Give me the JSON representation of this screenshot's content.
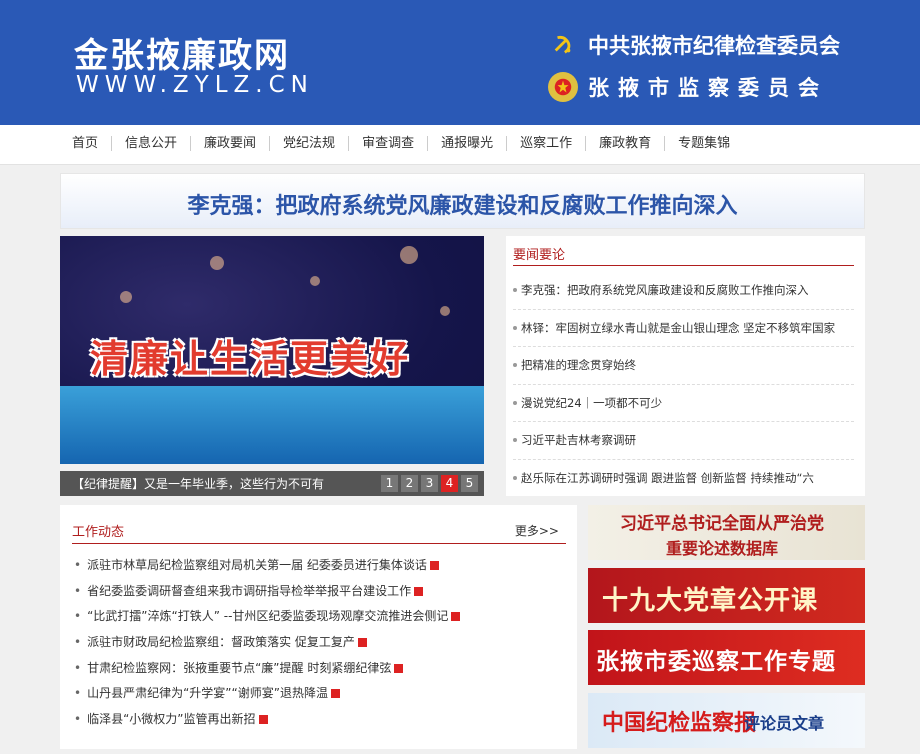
{
  "header": {
    "site_name": "金张掖廉政网",
    "site_url": "WWW.ZYLZ.CN",
    "org_line1": "中共张掖市纪律检查委员会",
    "org_line2": "张掖市监察委员会",
    "icons": [
      "party-emblem-icon",
      "national-emblem-icon"
    ]
  },
  "nav": {
    "items": [
      "首页",
      "信息公开",
      "廉政要闻",
      "党纪法规",
      "审查调查",
      "通报曝光",
      "巡察工作",
      "廉政教育",
      "专题集锦"
    ]
  },
  "headline": "李克强：把政府系统党风廉政建设和反腐败工作推向深入",
  "slider": {
    "image_text": "清廉让生活更美好",
    "caption": "【纪律提醒】又是一年毕业季，这些行为不可有",
    "pages": [
      "1",
      "2",
      "3",
      "4",
      "5"
    ],
    "active_page": "4"
  },
  "news": {
    "title": "要闻要论",
    "items": [
      "李克强：把政府系统党风廉政建设和反腐败工作推向深入",
      "林铎：牢固树立绿水青山就是金山银山理念 坚定不移筑牢国家",
      "把精准的理念贯穿始终",
      "漫说党纪24｜一项都不可少",
      "习近平赴吉林考察调研",
      "赵乐际在江苏调研时强调 跟进监督 创新监督 持续推动“六"
    ]
  },
  "work": {
    "title": "工作动态",
    "more": "更多>>",
    "items": [
      "派驻市林草局纪检监察组对局机关第一届 纪委委员进行集体谈话",
      "省纪委监委调研督查组来我市调研指导检举举报平台建设工作",
      "“比武打擂”淬炼“打铁人” --甘州区纪委监委现场观摩交流推进会侧记",
      "派驻市财政局纪检监察组：督政策落实 促复工复产",
      "甘肃纪检监察网：张掖重要节点“廉”提醒 时刻紧绷纪律弦",
      "山丹县严肃纪律为“升学宴”“谢师宴”退热降温",
      "临泽县“小微权力”监管再出新招"
    ]
  },
  "banners": {
    "b1_line1": "习近平总书记全面从严治党",
    "b1_line2": "重要论述数据库",
    "b2": "十九大党章公开课",
    "b3": "张掖市委巡察工作专题",
    "b4_main": "中国纪检监察报",
    "b4_sub": "评论员文章"
  }
}
